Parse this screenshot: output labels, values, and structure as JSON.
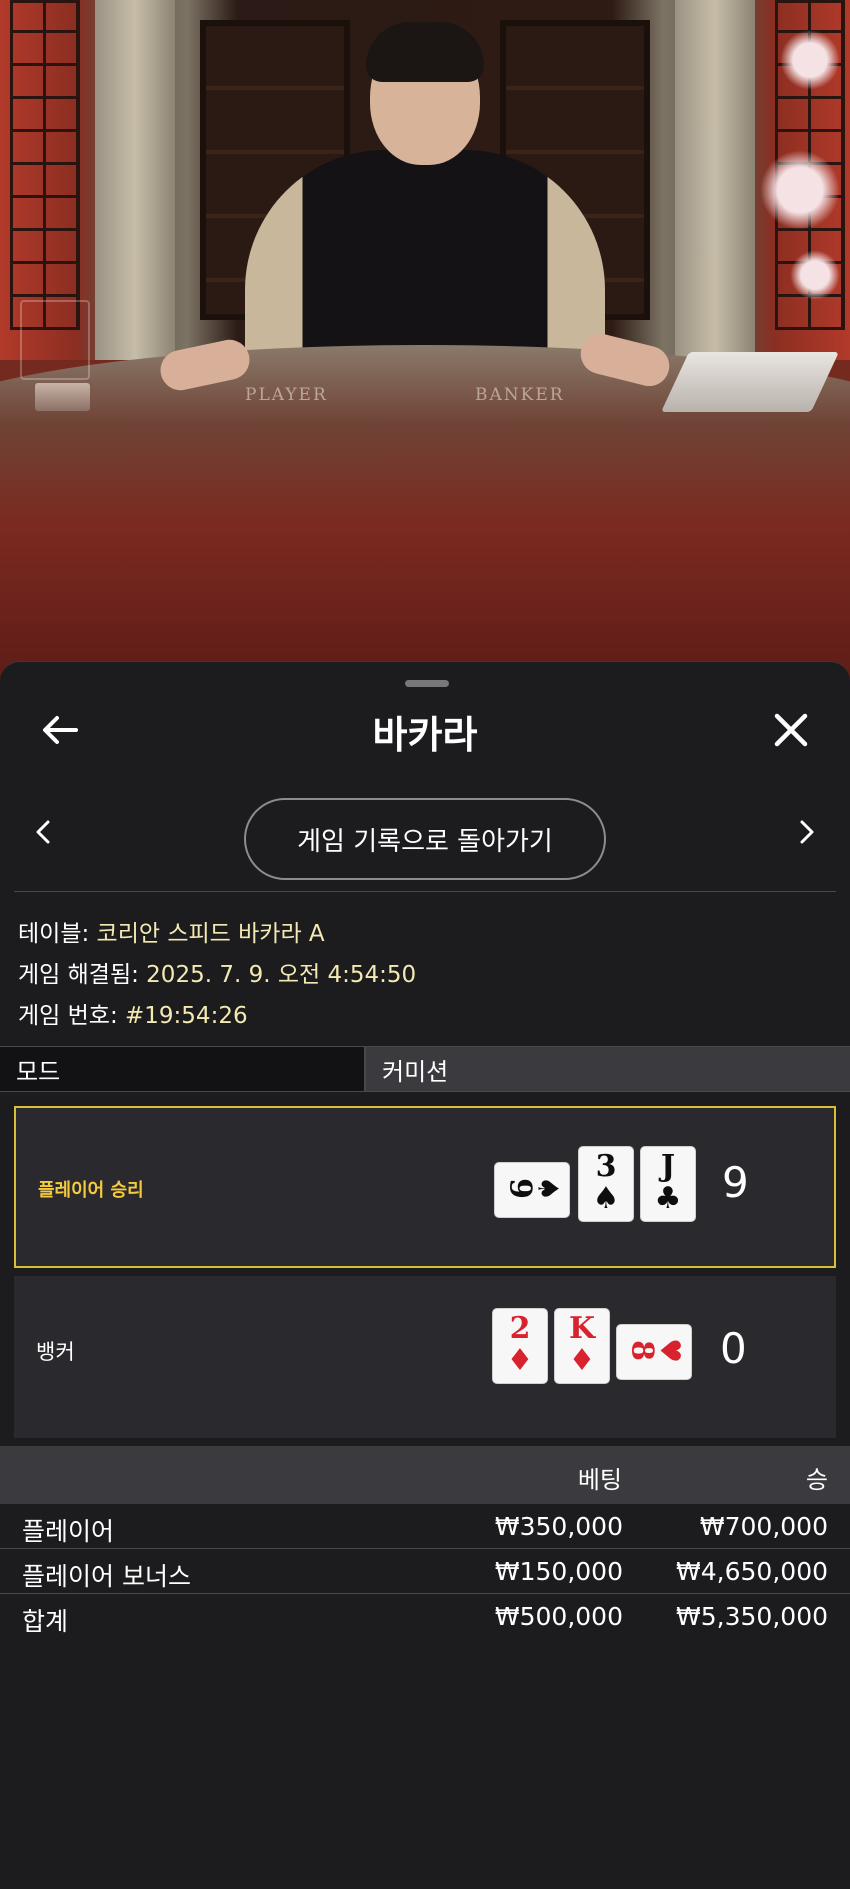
{
  "video": {
    "felt_player": "PLAYER",
    "felt_banker": "BANKER"
  },
  "sheet": {
    "title": "바카라",
    "back_icon": "arrow-left-icon",
    "close_icon": "close-icon",
    "prev_icon": "chevron-left-icon",
    "next_icon": "chevron-right-icon",
    "back_to_history_label": "게임 기록으로 돌아가기"
  },
  "info": {
    "table_label": "테이블: ",
    "table_value": "코리안 스피드 바카라 A",
    "resolved_label": "게임 해결됨: ",
    "resolved_value": "2025. 7. 9. 오전 4:54:50",
    "game_no_label": "게임 번호: ",
    "game_no_value": "#19:54:26"
  },
  "mode": {
    "label": "모드",
    "value": "커미션"
  },
  "results": {
    "player": {
      "label": "플레이어 승리",
      "score": "9",
      "cards": [
        {
          "rank": "9",
          "suit": "♠",
          "color": "black",
          "orientation": "horizontal"
        },
        {
          "rank": "3",
          "suit": "♠",
          "color": "black",
          "orientation": "vertical"
        },
        {
          "rank": "J",
          "suit": "♣",
          "color": "black",
          "orientation": "vertical"
        }
      ]
    },
    "banker": {
      "label": "뱅커",
      "score": "0",
      "cards": [
        {
          "rank": "2",
          "suit": "♦",
          "color": "red",
          "orientation": "vertical"
        },
        {
          "rank": "K",
          "suit": "♦",
          "color": "red",
          "orientation": "vertical"
        },
        {
          "rank": "8",
          "suit": "♥",
          "color": "red",
          "orientation": "horizontal"
        }
      ]
    }
  },
  "bets": {
    "header_bet": "베팅",
    "header_win": "승",
    "rows": [
      {
        "name": "플레이어",
        "bet": "₩350,000",
        "win": "₩700,000"
      },
      {
        "name": "플레이어 보너스",
        "bet": "₩150,000",
        "win": "₩4,650,000"
      },
      {
        "name": "합계",
        "bet": "₩500,000",
        "win": "₩5,350,000"
      }
    ]
  },
  "colors": {
    "accent_gold": "#d9be3a",
    "info_value": "#f3e9b2",
    "win_label": "#f3cb3c",
    "card_red": "#d8232e"
  }
}
